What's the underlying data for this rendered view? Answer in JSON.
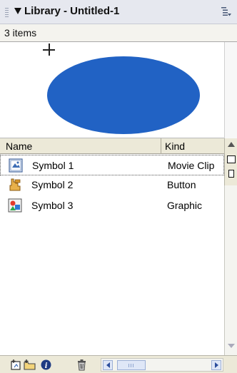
{
  "panel": {
    "title": "Library - Untitled-1",
    "item_count": "3 items"
  },
  "columns": {
    "name": "Name",
    "kind": "Kind"
  },
  "items": [
    {
      "name": "Symbol 1",
      "kind": "Movie Clip",
      "icon": "movie-clip-icon",
      "selected": true
    },
    {
      "name": "Symbol 2",
      "kind": "Button",
      "icon": "button-symbol-icon",
      "selected": false
    },
    {
      "name": "Symbol 3",
      "kind": "Graphic",
      "icon": "graphic-symbol-icon",
      "selected": false
    }
  ],
  "preview": {
    "shape": "ellipse",
    "fill_color": "#2162c4"
  },
  "toolbar": {
    "icons": [
      "new-symbol-icon",
      "new-folder-icon",
      "properties-icon",
      "delete-icon"
    ]
  }
}
